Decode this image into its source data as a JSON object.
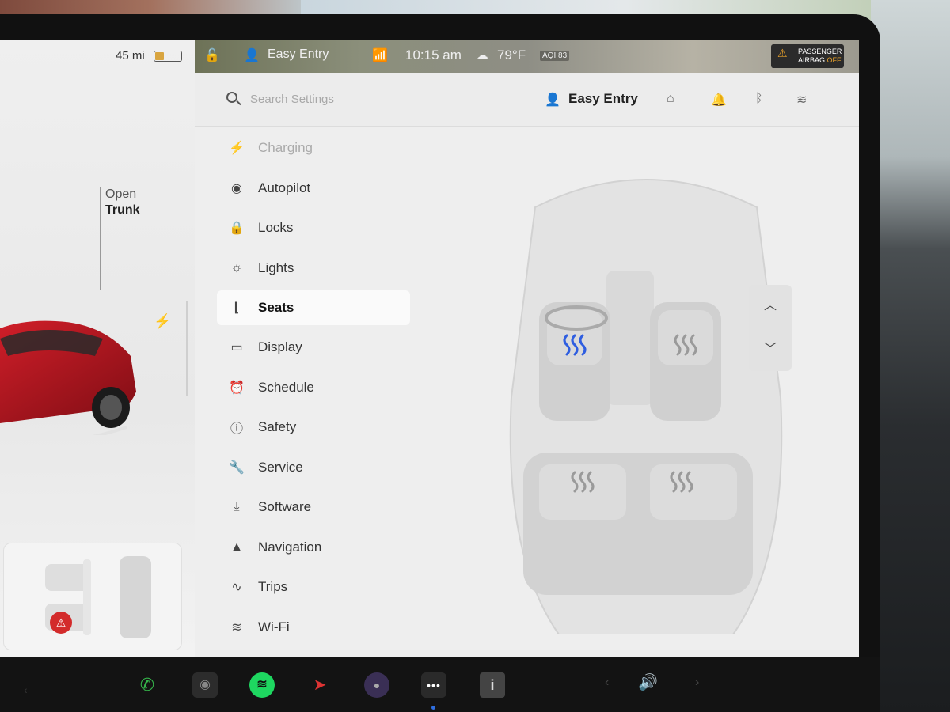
{
  "car_panel": {
    "range": "45 mi",
    "battery_fraction": 0.35,
    "trunk_label_1": "Open",
    "trunk_label_2": "Trunk"
  },
  "status_bar": {
    "profile": "Easy Entry",
    "time": "10:15 am",
    "temperature": "79°F",
    "aqi": "AQI 83",
    "airbag_line1": "PASSENGER",
    "airbag_line2": "AIRBAG",
    "airbag_state": "OFF"
  },
  "settings": {
    "search_placeholder": "Search Settings",
    "profile": "Easy Entry",
    "menu": [
      {
        "label": "Charging",
        "icon": "bolt-icon"
      },
      {
        "label": "Autopilot",
        "icon": "steering-wheel-icon"
      },
      {
        "label": "Locks",
        "icon": "lock-icon"
      },
      {
        "label": "Lights",
        "icon": "light-icon"
      },
      {
        "label": "Seats",
        "icon": "seat-icon",
        "active": true
      },
      {
        "label": "Display",
        "icon": "display-icon"
      },
      {
        "label": "Schedule",
        "icon": "schedule-icon"
      },
      {
        "label": "Safety",
        "icon": "safety-icon"
      },
      {
        "label": "Service",
        "icon": "wrench-icon"
      },
      {
        "label": "Software",
        "icon": "download-icon"
      },
      {
        "label": "Navigation",
        "icon": "navigation-icon"
      },
      {
        "label": "Trips",
        "icon": "trips-icon"
      },
      {
        "label": "Wi-Fi",
        "icon": "wifi-icon"
      }
    ]
  },
  "seat_heaters": {
    "driver_active": true,
    "heat_color_active": "#2f5ee0",
    "heat_color_idle": "#9a9a9a"
  },
  "colors": {
    "car_red": "#b3141e",
    "accent_blue": "#2f6ee0"
  }
}
